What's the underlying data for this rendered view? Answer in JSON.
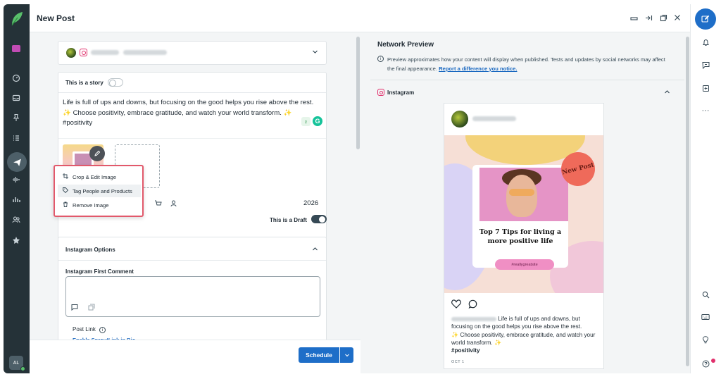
{
  "header": {
    "title": "New Post",
    "icons": [
      "minimize-icon",
      "collapse-icon",
      "popout-icon",
      "close-icon"
    ]
  },
  "leftnav": {
    "items": [
      "folder-icon",
      "dashboard-icon",
      "inbox-icon",
      "pin-icon",
      "tasks-icon",
      "publish-icon",
      "listening-icon",
      "reports-icon",
      "people-icon",
      "reviews-icon"
    ],
    "active": "publish-icon",
    "avatar_initials": "AL"
  },
  "composer": {
    "story_label": "This is a story",
    "post_text_line1": "Life is full of ups and downs, but focusing on the good helps you rise above the rest.",
    "post_text_line2": "✨ Choose positivity, embrace gratitude, and watch your world transform. ✨",
    "post_text_line3": "#positivity",
    "char_count": "2026",
    "draft_label": "This is a Draft"
  },
  "image_menu": {
    "items": [
      {
        "label": "Crop & Edit Image",
        "icon": "crop-icon"
      },
      {
        "label": "Tag People and Products",
        "icon": "tag-icon"
      },
      {
        "label": "Remove Image",
        "icon": "trash-icon"
      }
    ]
  },
  "instagram_options": {
    "title": "Instagram Options",
    "first_comment_label": "Instagram First Comment",
    "post_link_label": "Post Link",
    "enable_link_text": "Enable SproutLink in Bio"
  },
  "footer": {
    "schedule_label": "Schedule"
  },
  "preview": {
    "title": "Network Preview",
    "description": "Preview approximates how your content will display when published. Tests and updates by social networks may affect the final appearance.",
    "report_link": "Report a difference you notice.",
    "network_label": "Instagram",
    "badge_text": "New Post",
    "headline": "Top 7 Tips for living a more positive life",
    "pill_text": "#reallygreatsite",
    "caption_line1": "Life is full of ups and downs, but focusing on the good helps you rise above the rest.",
    "caption_line2": "✨ Choose positivity, embrace gratitude, and watch your world transform. ✨",
    "caption_hashtag": "#positivity",
    "date": "OCT 1"
  },
  "colors": {
    "accent": "#1e6ec8",
    "nav_bg": "#253238",
    "highlight_border": "#e2596b",
    "instagram": "#e1306c"
  }
}
